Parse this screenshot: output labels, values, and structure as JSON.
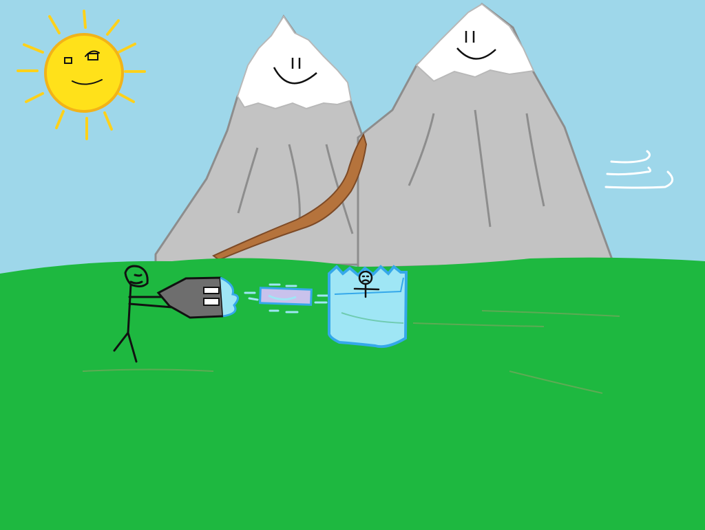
{
  "scene": {
    "colors": {
      "sky": "#9ed7ea",
      "grass": "#1eb840",
      "grass_line": "#7aa85a",
      "mountain": "#c3c3c3",
      "mountain_outline": "#8d8d8d",
      "snow": "#ffffff",
      "path": "#b5733c",
      "path_outline": "#7d4a26",
      "sun": "#ffe11a",
      "sun_outline": "#f2b318",
      "ink": "#111111",
      "cannon": "#6e6e6e",
      "beam": "#c9c2ec",
      "ice": "#9fe6f5",
      "ice_edge": "#35a8ea",
      "wind": "#ffffff"
    },
    "icons": [
      "sun-icon",
      "mountain-icon",
      "stick-figure-icon",
      "ice-cannon-icon",
      "ice-block-icon",
      "wind-icon"
    ]
  }
}
